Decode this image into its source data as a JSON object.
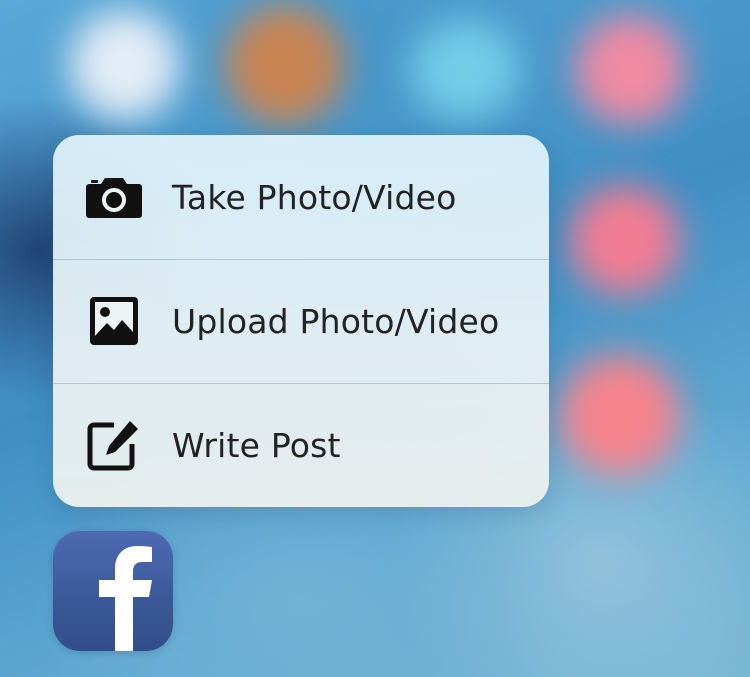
{
  "quick_actions": {
    "items": [
      {
        "label": "Take Photo/Video",
        "icon": "camera-icon"
      },
      {
        "label": "Upload Photo/Video",
        "icon": "photo-icon"
      },
      {
        "label": "Write Post",
        "icon": "compose-icon"
      }
    ]
  },
  "app_icon": {
    "glyph": "f",
    "icon": "facebook-app-icon",
    "brand_color": "#3b5998"
  }
}
